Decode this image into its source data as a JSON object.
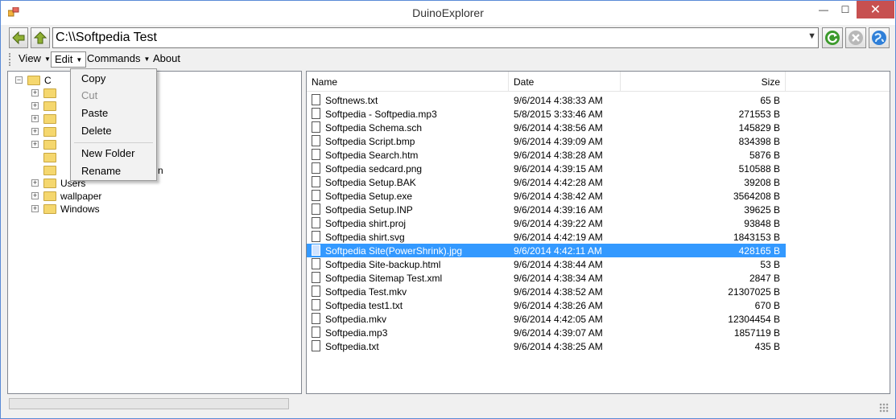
{
  "window": {
    "title": "DuinoExplorer",
    "minimize_glyph": "—",
    "maximize_glyph": "☐",
    "close_glyph": "✕"
  },
  "address": {
    "path": "C:\\\\Softpedia Test"
  },
  "menu": {
    "view": "View",
    "edit": "Edit",
    "commands": "Commands",
    "about": "About"
  },
  "edit_menu": {
    "copy": "Copy",
    "cut": "Cut",
    "paste": "Paste",
    "delete": "Delete",
    "new_folder": "New Folder",
    "rename": "Rename"
  },
  "tree": {
    "root_label": "C",
    "partial_label": "n",
    "items": [
      "Users",
      "wallpaper",
      "Windows"
    ]
  },
  "list": {
    "headers": {
      "name": "Name",
      "date": "Date",
      "size": "Size"
    },
    "selected_index": 11,
    "rows": [
      {
        "name": "Softnews.txt",
        "date": "9/6/2014 4:38:33 AM",
        "size": "65 B"
      },
      {
        "name": "Softpedia - Softpedia.mp3",
        "date": "5/8/2015 3:33:46 AM",
        "size": "271553 B"
      },
      {
        "name": "Softpedia Schema.sch",
        "date": "9/6/2014 4:38:56 AM",
        "size": "145829 B"
      },
      {
        "name": "Softpedia Script.bmp",
        "date": "9/6/2014 4:39:09 AM",
        "size": "834398 B"
      },
      {
        "name": "Softpedia Search.htm",
        "date": "9/6/2014 4:38:28 AM",
        "size": "5876 B"
      },
      {
        "name": "Softpedia sedcard.png",
        "date": "9/6/2014 4:39:15 AM",
        "size": "510588 B"
      },
      {
        "name": "Softpedia Setup.BAK",
        "date": "9/6/2014 4:42:28 AM",
        "size": "39208 B"
      },
      {
        "name": "Softpedia Setup.exe",
        "date": "9/6/2014 4:38:42 AM",
        "size": "3564208 B"
      },
      {
        "name": "Softpedia Setup.INP",
        "date": "9/6/2014 4:39:16 AM",
        "size": "39625 B"
      },
      {
        "name": "Softpedia shirt.proj",
        "date": "9/6/2014 4:39:22 AM",
        "size": "93848 B"
      },
      {
        "name": "Softpedia shirt.svg",
        "date": "9/6/2014 4:42:19 AM",
        "size": "1843153 B"
      },
      {
        "name": "Softpedia Site(PowerShrink).jpg",
        "date": "9/6/2014 4:42:11 AM",
        "size": "428165 B"
      },
      {
        "name": "Softpedia Site-backup.html",
        "date": "9/6/2014 4:38:44 AM",
        "size": "53 B"
      },
      {
        "name": "Softpedia Sitemap Test.xml",
        "date": "9/6/2014 4:38:34 AM",
        "size": "2847 B"
      },
      {
        "name": "Softpedia Test.mkv",
        "date": "9/6/2014 4:38:52 AM",
        "size": "21307025 B"
      },
      {
        "name": "Softpedia test1.txt",
        "date": "9/6/2014 4:38:26 AM",
        "size": "670 B"
      },
      {
        "name": "Softpedia.mkv",
        "date": "9/6/2014 4:42:05 AM",
        "size": "12304454 B"
      },
      {
        "name": "Softpedia.mp3",
        "date": "9/6/2014 4:39:07 AM",
        "size": "1857119 B"
      },
      {
        "name": "Softpedia.txt",
        "date": "9/6/2014 4:38:25 AM",
        "size": "435 B"
      }
    ]
  },
  "colors": {
    "selection": "#3399ff",
    "folder": "#f5d76e",
    "close_button": "#c75050",
    "window_border": "#5a8ad6"
  }
}
